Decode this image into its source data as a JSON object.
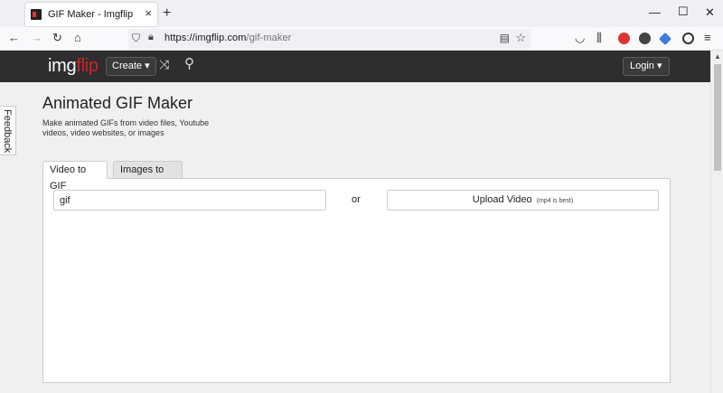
{
  "browser": {
    "tab_title": "GIF Maker - Imgflip",
    "url_host": "https://imgflip.com",
    "url_path": "/gif-maker",
    "icons": [
      "back-icon",
      "forward-icon",
      "reload-icon",
      "home-icon",
      "shield-icon",
      "lock-icon",
      "reader-mode-icon",
      "bookmark-star-icon",
      "pocket-icon",
      "library-icon",
      "menu-icon"
    ]
  },
  "header": {
    "logo_main": "img",
    "logo_accent": "flip",
    "create_label": "Create ▾",
    "login_label": "Login ▾"
  },
  "sidebar": {
    "feedback_label": "Feedback"
  },
  "main": {
    "title": "Animated GIF Maker",
    "description": "Make animated GIFs from video files, Youtube videos, video websites, or images",
    "tabs": [
      {
        "label": "Video to GIF",
        "active": true
      },
      {
        "label": "Images to GIF",
        "active": false
      }
    ],
    "url_input_value": "gif",
    "or_label": "or",
    "upload_label": "Upload Video",
    "upload_hint": "(mp4 is best)"
  },
  "colors": {
    "header_bg": "#2e2e2e",
    "logo_accent": "#d0212a",
    "page_bg": "#f0f0f0"
  }
}
